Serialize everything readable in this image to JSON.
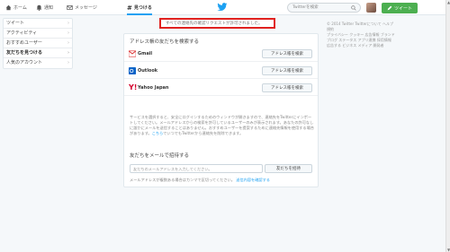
{
  "nav": {
    "home": "ホーム",
    "notifications": "通知",
    "messages": "メッセージ",
    "discover": "見つける",
    "search_placeholder": "Twitterを検索",
    "tweet_button": "ツイート"
  },
  "alert": "すべての連絡先の確認リクエストが許可されました。",
  "sidebar": {
    "items": [
      {
        "label": "ツイート"
      },
      {
        "label": "アクティビティ"
      },
      {
        "label": "おすすめユーザー"
      },
      {
        "label": "友だちを見つける"
      },
      {
        "label": "人気のアカウント"
      }
    ]
  },
  "main": {
    "section_title": "アドレス帳の友だちを検索する",
    "providers": [
      {
        "name": "Gmail",
        "button": "アドレス帳を検索"
      },
      {
        "name": "Outlook",
        "button": "アドレス帳を検索"
      },
      {
        "name": "Yahoo Japan",
        "button": "アドレス帳を検索"
      }
    ],
    "notice_text": "サービスを選択すると、安全にログインするためのウィンドウが開きますので、連絡先をTwitterにインポートしてください。メールアドレスからの検索を許可しているユーザーのみが表示されます。あなたの許可なしに誰かにメールを送信することはありません。おすすめユーザーを提案するために連絡先情報を使用する場合があります。",
    "notice_link": "こちら",
    "notice_tail": "でいつでもTwitterから連絡先を削除できます。",
    "invite_title": "友だちをメールで招待する",
    "invite_placeholder": "友だちのメールアドレスを入力してください。",
    "invite_button": "友だちを招待",
    "invite_note": "メールアドレスが複数ある場合はカンマで区切ってください。",
    "invite_note_link": "送信内容を確認する"
  },
  "footer": {
    "lines": [
      "© 2014 Twitter Twitterについて ヘルプ 規約",
      "プライバシー クッキー 広告情報 ブランド",
      "ブログ ステータス アプリ連携 採用情報",
      "広告する ビジネス メディア 開発者"
    ]
  },
  "icons": {
    "home": "home-icon",
    "notifications": "bell-icon",
    "messages": "mail-icon",
    "discover": "hashtag-icon",
    "bird": "twitter-bird-icon"
  },
  "colors": {
    "accent": "#1da1f2",
    "alert_border": "#e0211f",
    "tweet_button": "#4caf50"
  }
}
